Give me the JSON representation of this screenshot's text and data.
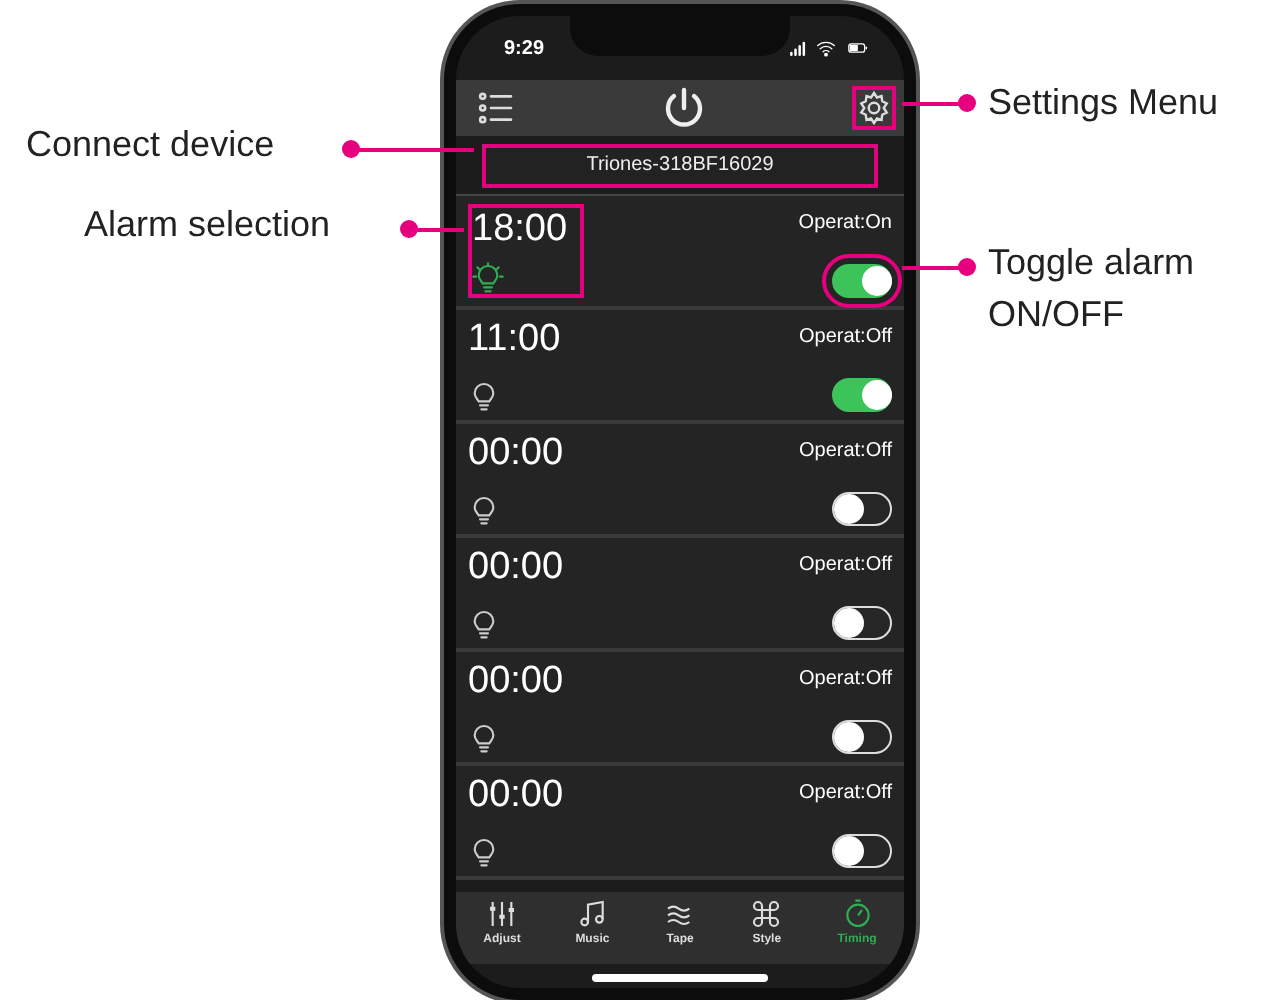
{
  "status_bar": {
    "time": "9:29"
  },
  "header": {
    "settings_highlighted": true
  },
  "device": {
    "name": "Triones-318BF16029",
    "highlighted": true
  },
  "alarms": [
    {
      "time": "18:00",
      "status": "Operat:On",
      "lit": true,
      "on": true,
      "highlighted": true
    },
    {
      "time": "11:00",
      "status": "Operat:Off",
      "lit": false,
      "on": true,
      "highlighted": false
    },
    {
      "time": "00:00",
      "status": "Operat:Off",
      "lit": false,
      "on": false,
      "highlighted": false
    },
    {
      "time": "00:00",
      "status": "Operat:Off",
      "lit": false,
      "on": false,
      "highlighted": false
    },
    {
      "time": "00:00",
      "status": "Operat:Off",
      "lit": false,
      "on": false,
      "highlighted": false
    },
    {
      "time": "00:00",
      "status": "Operat:Off",
      "lit": false,
      "on": false,
      "highlighted": false
    }
  ],
  "tabs": [
    {
      "label": "Adjust",
      "kind": "adjust",
      "selected": false
    },
    {
      "label": "Music",
      "kind": "music",
      "selected": false
    },
    {
      "label": "Tape",
      "kind": "tape",
      "selected": false
    },
    {
      "label": "Style",
      "kind": "style",
      "selected": false
    },
    {
      "label": "Timing",
      "kind": "timing",
      "selected": true
    }
  ],
  "callouts": [
    {
      "text": "Settings Menu"
    },
    {
      "text": "Connect device"
    },
    {
      "text": "Alarm selection"
    },
    {
      "text": "Toggle alarm ON/OFF"
    }
  ]
}
